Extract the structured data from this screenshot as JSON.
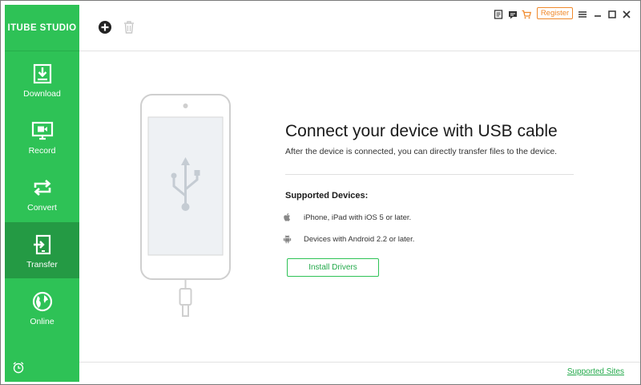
{
  "app": {
    "title": "ITUBE STUDIO"
  },
  "sidebar": {
    "items": [
      {
        "label": "Download",
        "icon": "download-icon",
        "active": false
      },
      {
        "label": "Record",
        "icon": "record-icon",
        "active": false
      },
      {
        "label": "Convert",
        "icon": "convert-icon",
        "active": false
      },
      {
        "label": "Transfer",
        "icon": "transfer-icon",
        "active": true
      },
      {
        "label": "Online",
        "icon": "online-icon",
        "active": false
      }
    ],
    "footer_icon": "alarm-clock-icon"
  },
  "toolbar": {
    "add_icon": "add-circle-icon",
    "delete_icon": "trash-icon"
  },
  "window_controls": {
    "register_label": "Register",
    "icons": [
      "notes-icon",
      "feedback-icon",
      "cart-icon",
      "menu-icon",
      "minimize-icon",
      "maximize-icon",
      "close-icon"
    ]
  },
  "main": {
    "title": "Connect your device with USB cable",
    "subtitle": "After the device is connected, you can directly transfer files to the device.",
    "supported_title": "Supported Devices:",
    "devices": [
      {
        "icon": "apple-icon",
        "text": "iPhone, iPad with iOS 5 or later."
      },
      {
        "icon": "android-icon",
        "text": "Devices with Android 2.2 or later."
      }
    ],
    "install_label": "Install Drivers"
  },
  "footer": {
    "supported_sites_label": "Supported Sites"
  },
  "colors": {
    "sidebar_green": "#2ec256",
    "active_green": "#249a44",
    "register_orange": "#f08a2c",
    "link_green": "#22a94a"
  }
}
